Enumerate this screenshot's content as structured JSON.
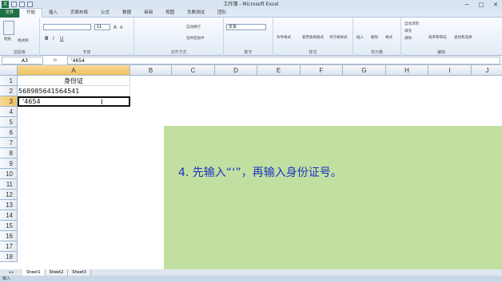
{
  "window": {
    "title": "工作簿 - Microsoft Excel",
    "minimize": "─",
    "maximize": "□",
    "close": "✕"
  },
  "tabs": [
    "文件",
    "开始",
    "插入",
    "页面布局",
    "公式",
    "数据",
    "审阅",
    "视图",
    "负数测试",
    "团队"
  ],
  "ribbon": {
    "clipboard": {
      "label": "剪贴板",
      "paste": "粘贴",
      "format_painter": "格式刷"
    },
    "font": {
      "label": "字体",
      "size": "11",
      "bold": "B",
      "italic": "I",
      "underline": "U",
      "grow": "A",
      "shrink": "A"
    },
    "alignment": {
      "label": "对齐方式",
      "wrap": "自动换行",
      "merge": "合并后居中"
    },
    "number": {
      "label": "数字",
      "format": "文本"
    },
    "styles": {
      "label": "样式",
      "conditional": "条件格式",
      "table": "套用表格格式",
      "cell_styles": "单元格样式"
    },
    "cells": {
      "label": "单元格",
      "insert": "插入",
      "delete": "删除",
      "format": "格式"
    },
    "editing": {
      "label": "编辑",
      "autosum": "自动求和",
      "fill": "填充",
      "clear": "清除",
      "sort": "排序和筛选",
      "find": "查找和选择"
    }
  },
  "formula_bar": {
    "name_box": "A3",
    "fx": "fx",
    "value": "'4654"
  },
  "columns": [
    "A",
    "B",
    "C",
    "D",
    "E",
    "F",
    "G",
    "H",
    "I",
    "J"
  ],
  "rows": [
    "1",
    "2",
    "3",
    "4",
    "5",
    "6",
    "7",
    "8",
    "9",
    "10",
    "11",
    "12",
    "13",
    "14",
    "15",
    "16",
    "17",
    "18"
  ],
  "cells": {
    "A1": "身份证",
    "A2": "568985641564541",
    "A3": "'4654"
  },
  "annotation": "4. 先输入“‘”，再输入身份证号。",
  "sheet_tabs": [
    "Sheet1",
    "Sheet2",
    "Sheet3"
  ],
  "status": "输入",
  "colors": {
    "accent": "#1f7044",
    "overlay": "#b0d685",
    "caption": "#1b36c5"
  }
}
